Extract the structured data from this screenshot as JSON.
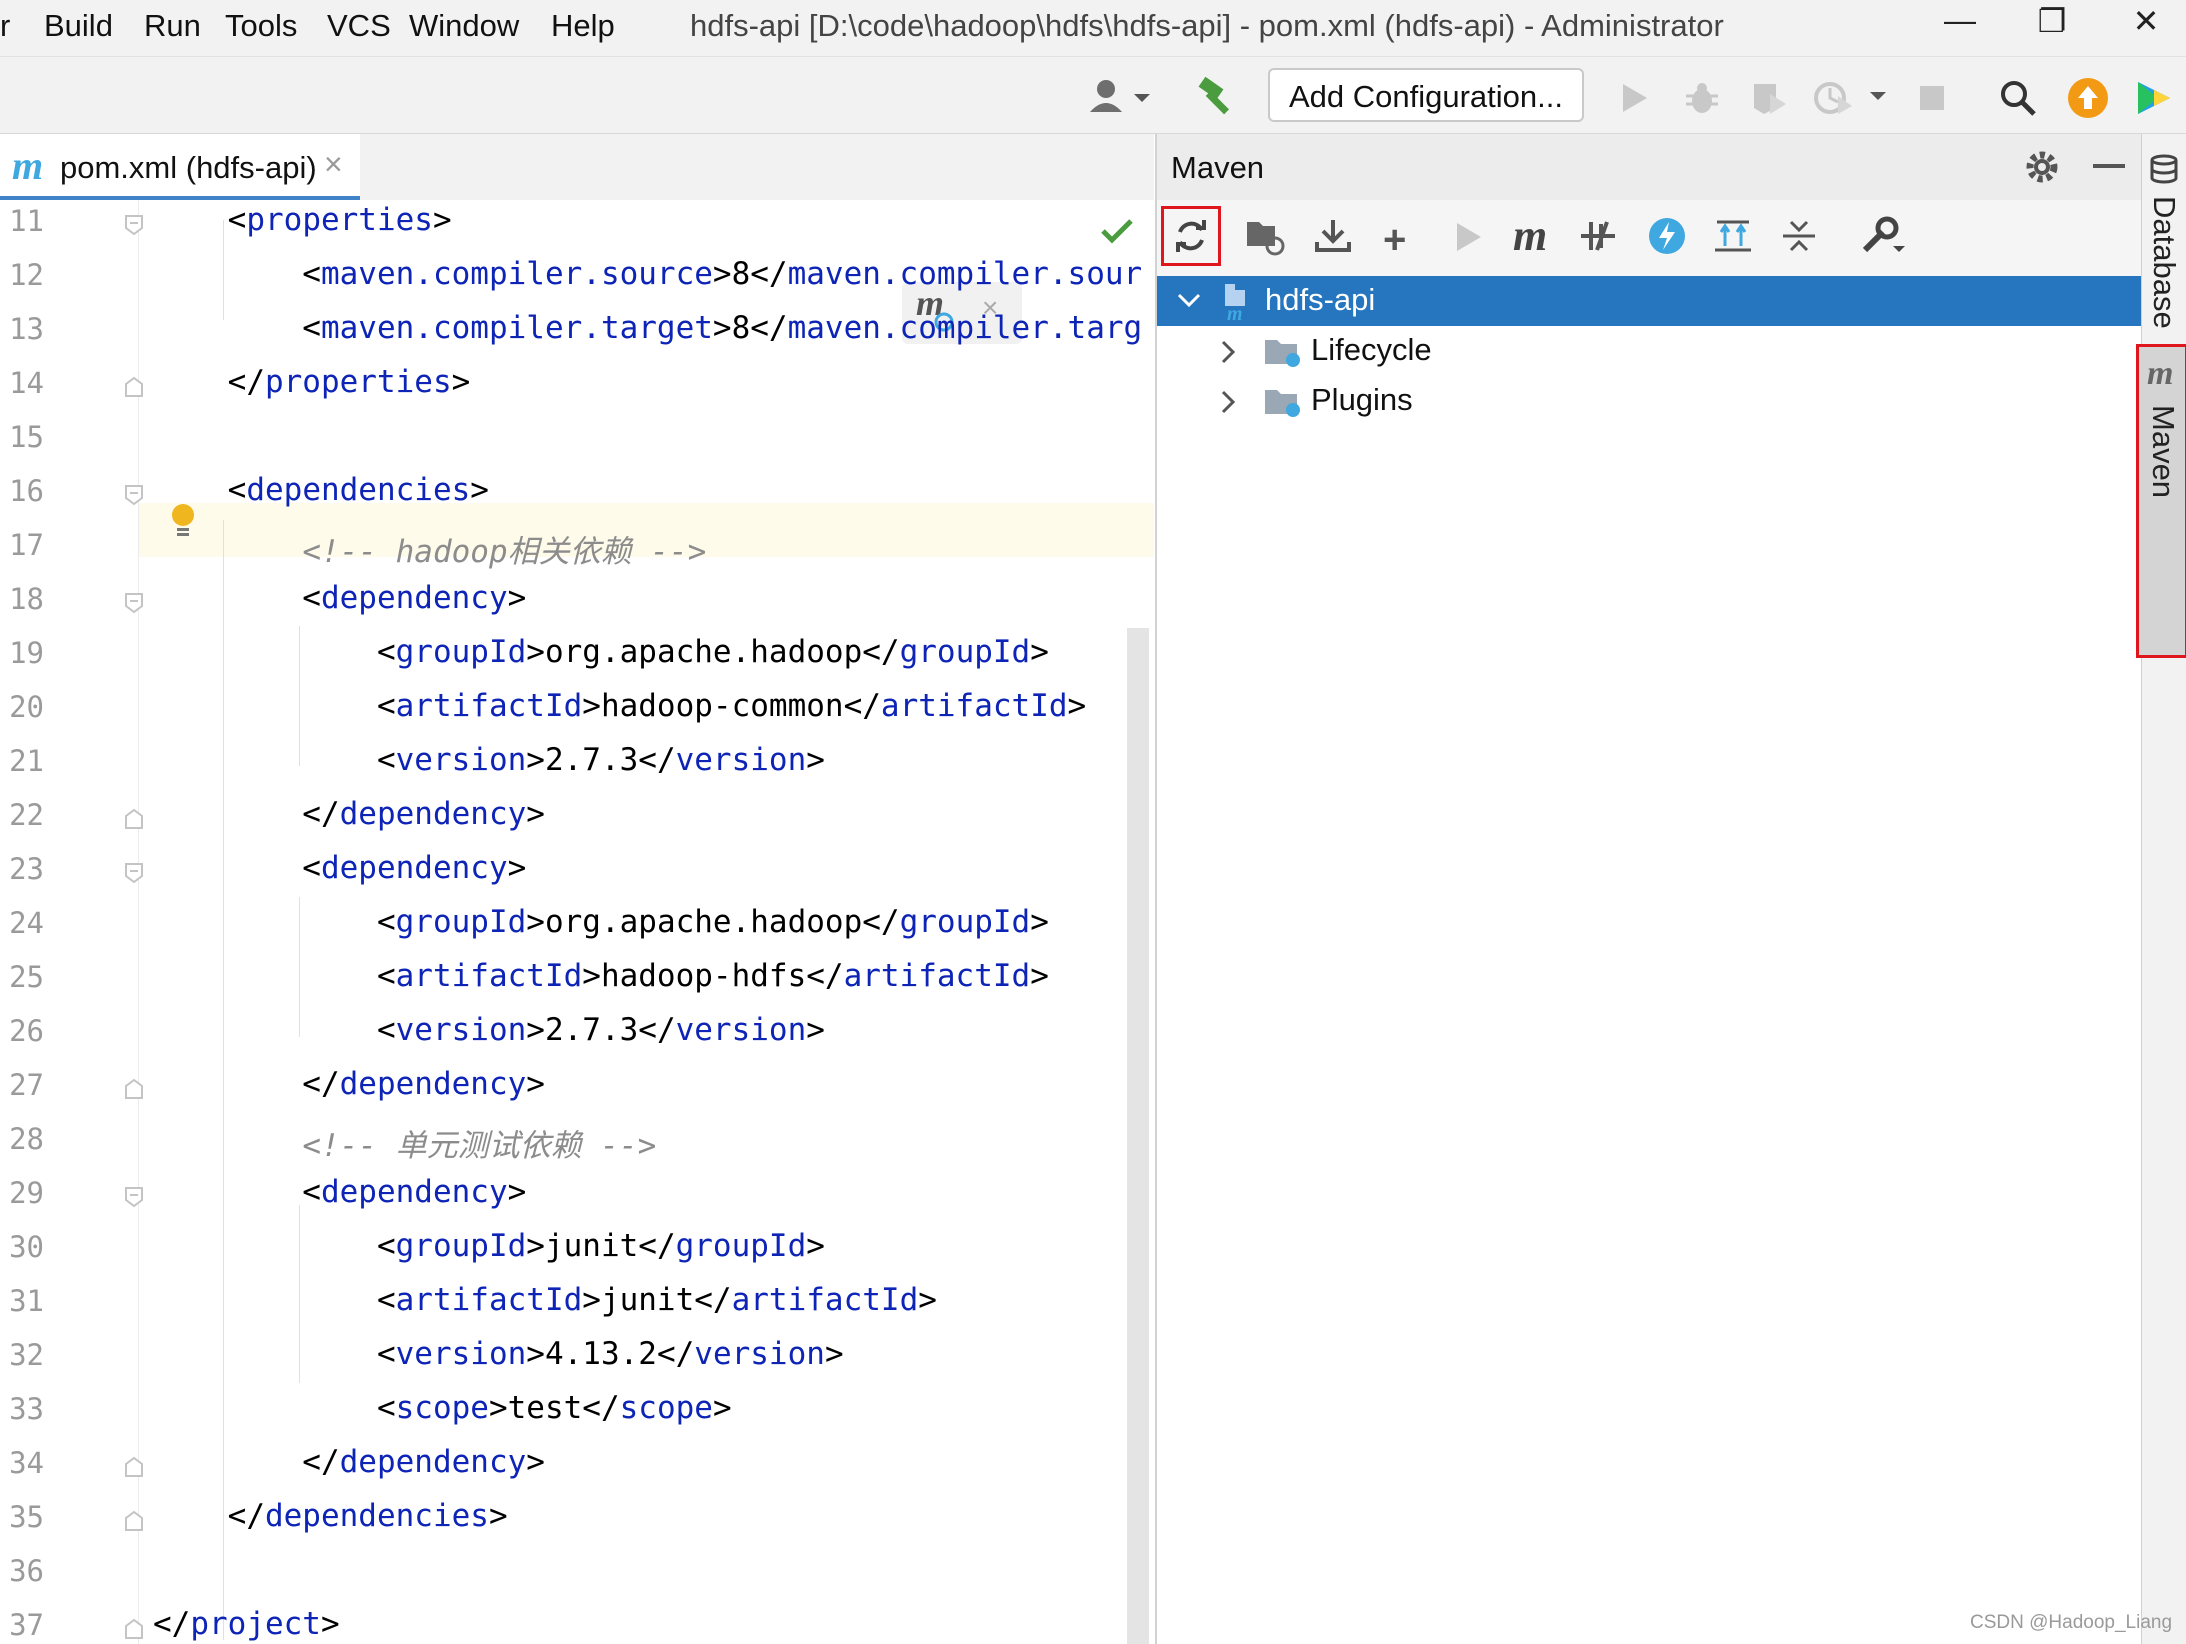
{
  "menu": {
    "items": [
      "r",
      "Build",
      "Run",
      "Tools",
      "VCS",
      "Window",
      "Help"
    ],
    "window_title": "hdfs-api [D:\\code\\hadoop\\hdfs\\hdfs-api] - pom.xml (hdfs-api) - Administrator",
    "controls": {
      "minimize": "—",
      "restore": "❐",
      "close": "✕"
    }
  },
  "toolbar": {
    "add_configuration": "Add Configuration...",
    "icons": [
      "user-icon",
      "build-hammer-icon",
      "run-icon",
      "debug-icon",
      "coverage-icon",
      "profile-icon",
      "stop-icon",
      "search-icon",
      "update-icon",
      "toolbox-icon"
    ]
  },
  "editor": {
    "tab_label": "pom.xml (hdfs-api)",
    "tab_close": "×",
    "lines": [
      {
        "num": "11",
        "html": "    &lt;<span class='tag'>properties</span>&gt;"
      },
      {
        "num": "12",
        "html": "        &lt;<span class='tag'>maven.compiler.source</span>&gt;8&lt;/<span class='tag'>maven.compiler.sour</span>"
      },
      {
        "num": "13",
        "html": "        &lt;<span class='tag'>maven.compiler.target</span>&gt;8&lt;/<span class='tag'>maven.compiler.targ</span>"
      },
      {
        "num": "14",
        "html": "    &lt;/<span class='tag'>properties</span>&gt;"
      },
      {
        "num": "15",
        "html": ""
      },
      {
        "num": "16",
        "html": "    &lt;<span class='tag'>dependencies</span>&gt;"
      },
      {
        "num": "17",
        "html": "        <span class='cmt'>&lt;!-- hadoop相关依赖 --&gt;</span>"
      },
      {
        "num": "18",
        "html": "        &lt;<span class='tag'>dependency</span>&gt;"
      },
      {
        "num": "19",
        "html": "            &lt;<span class='tag'>groupId</span>&gt;org.apache.hadoop&lt;/<span class='tag'>groupId</span>&gt;"
      },
      {
        "num": "20",
        "html": "            &lt;<span class='tag'>artifactId</span>&gt;hadoop-common&lt;/<span class='tag'>artifactId</span>&gt;"
      },
      {
        "num": "21",
        "html": "            &lt;<span class='tag'>version</span>&gt;2.7.3&lt;/<span class='tag'>version</span>&gt;"
      },
      {
        "num": "22",
        "html": "        &lt;/<span class='tag'>dependency</span>&gt;"
      },
      {
        "num": "23",
        "html": "        &lt;<span class='tag'>dependency</span>&gt;"
      },
      {
        "num": "24",
        "html": "            &lt;<span class='tag'>groupId</span>&gt;org.apache.hadoop&lt;/<span class='tag'>groupId</span>&gt;"
      },
      {
        "num": "25",
        "html": "            &lt;<span class='tag'>artifactId</span>&gt;hadoop-hdfs&lt;/<span class='tag'>artifactId</span>&gt;"
      },
      {
        "num": "26",
        "html": "            &lt;<span class='tag'>version</span>&gt;2.7.3&lt;/<span class='tag'>version</span>&gt;"
      },
      {
        "num": "27",
        "html": "        &lt;/<span class='tag'>dependency</span>&gt;"
      },
      {
        "num": "28",
        "html": "        <span class='cmt'>&lt;!-- 单元测试依赖 --&gt;</span>"
      },
      {
        "num": "29",
        "html": "        &lt;<span class='tag'>dependency</span>&gt;"
      },
      {
        "num": "30",
        "html": "            &lt;<span class='tag'>groupId</span>&gt;junit&lt;/<span class='tag'>groupId</span>&gt;"
      },
      {
        "num": "31",
        "html": "            &lt;<span class='tag'>artifactId</span>&gt;junit&lt;/<span class='tag'>artifactId</span>&gt;"
      },
      {
        "num": "32",
        "html": "            &lt;<span class='tag'>version</span>&gt;4.13.2&lt;/<span class='tag'>version</span>&gt;"
      },
      {
        "num": "33",
        "html": "            &lt;<span class='tag'>scope</span>&gt;test&lt;/<span class='tag'>scope</span>&gt;"
      },
      {
        "num": "34",
        "html": "        &lt;/<span class='tag'>dependency</span>&gt;"
      },
      {
        "num": "35",
        "html": "    &lt;/<span class='tag'>dependencies</span>&gt;"
      },
      {
        "num": "36",
        "html": ""
      },
      {
        "num": "37",
        "html": "&lt;/<span class='tag'>project</span>&gt;"
      }
    ]
  },
  "maven": {
    "title": "Maven",
    "tools": [
      "reload-icon",
      "generate-sources-icon",
      "download-icon",
      "add-icon",
      "run-icon",
      "execute-goal-icon",
      "toggle-offline-icon",
      "skip-tests-icon",
      "show-dependencies-icon",
      "collapse-all-icon",
      "settings-wrench-icon"
    ],
    "tree": {
      "root": "hdfs-api",
      "children": [
        "Lifecycle",
        "Plugins"
      ]
    }
  },
  "side_tabs": {
    "database": "Database",
    "maven": "Maven",
    "maven_glyph": "m"
  },
  "watermark": "CSDN @Hadoop_Liang",
  "colors": {
    "accent": "#2675bf",
    "highlight_box": "#e0161d",
    "tag": "#0d24b6",
    "comment": "#8c8c8c"
  }
}
